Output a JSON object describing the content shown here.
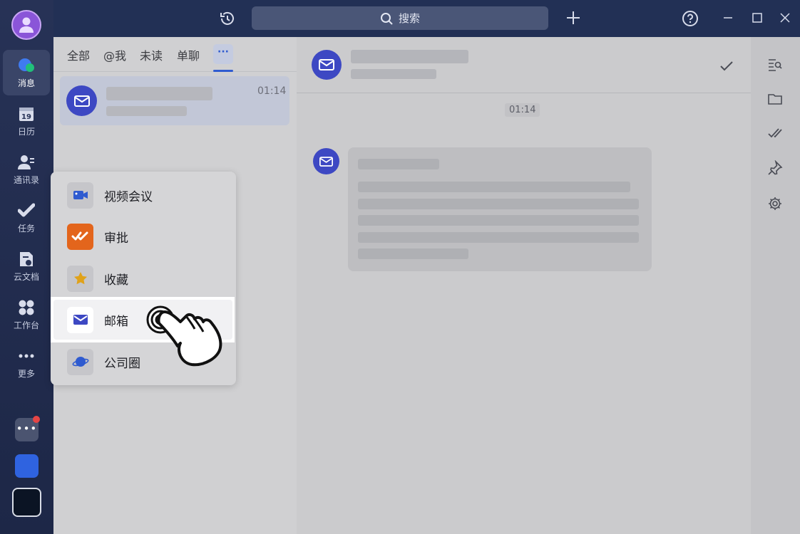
{
  "sidebar": {
    "items": [
      {
        "label": "消息",
        "icon": "chat-bubble-icon",
        "active": true
      },
      {
        "label": "日历",
        "icon": "calendar-icon",
        "day": "19"
      },
      {
        "label": "通讯录",
        "icon": "contacts-icon"
      },
      {
        "label": "任务",
        "icon": "task-check-icon"
      },
      {
        "label": "云文档",
        "icon": "cloud-doc-icon"
      },
      {
        "label": "工作台",
        "icon": "workspace-grid-icon"
      },
      {
        "label": "更多",
        "icon": "more-dots-icon"
      }
    ],
    "bottom_dots": "•••"
  },
  "topbar": {
    "search_placeholder": "搜索"
  },
  "conversation_list": {
    "tabs": [
      "全部",
      "@我",
      "未读",
      "单聊"
    ],
    "more_tab": "···",
    "conversations": [
      {
        "time": "01:14",
        "icon": "mail-icon"
      }
    ]
  },
  "chat": {
    "message_time": "01:14"
  },
  "menu": {
    "items": [
      {
        "label": "视频会议",
        "icon": "video-camera-icon"
      },
      {
        "label": "审批",
        "icon": "approval-icon"
      },
      {
        "label": "收藏",
        "icon": "star-icon"
      },
      {
        "label": "邮箱",
        "icon": "mail-icon",
        "highlighted": true
      },
      {
        "label": "公司圈",
        "icon": "planet-icon"
      }
    ]
  },
  "colors": {
    "accent": "#2f5bd0",
    "mail_avatar": "#3d48c3",
    "rail": "#273256",
    "badge": "#e64545"
  }
}
